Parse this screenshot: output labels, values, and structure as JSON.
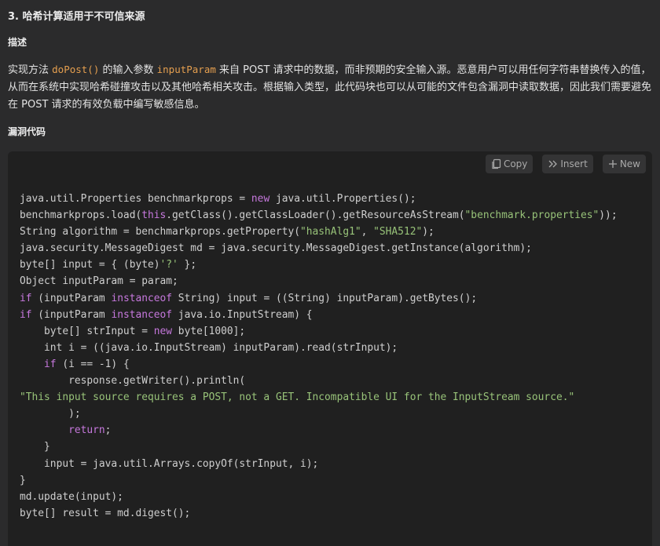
{
  "heading": "3. 哈希计算适用于不可信来源",
  "sections": {
    "description_title": "描述",
    "code_title": "漏洞代码"
  },
  "description": {
    "p1": "实现方法 ",
    "c1": "doPost()",
    "p2": " 的输入参数 ",
    "c2": "inputParam",
    "p3": " 来自 POST 请求中的数据，而非预期的安全输入源。恶意用户可以用任何字符串替换传入的值，从而在系统中实现哈希碰撞攻击以及其他哈希相关攻击。根据输入类型，此代码块也可以从可能的文件包含漏洞中读取数据，因此我们需要避免在 POST 请求的有效负载中编写敏感信息。"
  },
  "toolbar": {
    "copy_label": "Copy",
    "insert_label": "Insert",
    "new_label": "New",
    "icons": [
      "copy-icon",
      "insert-icon",
      "plus-icon"
    ]
  },
  "colors": {
    "keyword": "#c678dd",
    "string": "#98c379",
    "inline_code": "#e59f4f",
    "code_bg": "#202020",
    "page_bg": "#2b2b2c"
  },
  "code": [
    [
      [
        "p",
        "java.util.Properties benchmarkprops = "
      ],
      [
        "k",
        "new"
      ],
      [
        "p",
        " java.util.Properties();"
      ]
    ],
    [
      [
        "p",
        "benchmarkprops.load("
      ],
      [
        "k",
        "this"
      ],
      [
        "p",
        ".getClass().getClassLoader().getResourceAsStream("
      ],
      [
        "s",
        "\"benchmark.properties\""
      ],
      [
        "p",
        "));"
      ]
    ],
    [
      [
        "p",
        "String algorithm = benchmarkprops.getProperty("
      ],
      [
        "s",
        "\"hashAlg1\""
      ],
      [
        "p",
        ", "
      ],
      [
        "s",
        "\"SHA512\""
      ],
      [
        "p",
        ");"
      ]
    ],
    [
      [
        "p",
        "java.security.MessageDigest md = java.security.MessageDigest.getInstance(algorithm);"
      ]
    ],
    [
      [
        "p",
        "byte[] input = { (byte)"
      ],
      [
        "s",
        "'?'"
      ],
      [
        "p",
        " };"
      ]
    ],
    [
      [
        "p",
        "Object inputParam = param;"
      ]
    ],
    [
      [
        "k",
        "if"
      ],
      [
        "p",
        " (inputParam "
      ],
      [
        "k",
        "instanceof"
      ],
      [
        "p",
        " String) input = ((String) inputParam).getBytes();"
      ]
    ],
    [
      [
        "k",
        "if"
      ],
      [
        "p",
        " (inputParam "
      ],
      [
        "k",
        "instanceof"
      ],
      [
        "p",
        " java.io.InputStream) {"
      ]
    ],
    [
      [
        "p",
        "    byte[] strInput = "
      ],
      [
        "k",
        "new"
      ],
      [
        "p",
        " byte[1000];"
      ]
    ],
    [
      [
        "p",
        "    int i = ((java.io.InputStream) inputParam).read(strInput);"
      ]
    ],
    [
      [
        "p",
        "    "
      ],
      [
        "k",
        "if"
      ],
      [
        "p",
        " (i == -1) {"
      ]
    ],
    [
      [
        "p",
        "        response.getWriter().println("
      ]
    ],
    [
      [
        "s",
        "\"This input source requires a POST, not a GET. Incompatible UI for the InputStream source.\""
      ]
    ],
    [
      [
        "p",
        "        );"
      ]
    ],
    [
      [
        "p",
        "        "
      ],
      [
        "k",
        "return"
      ],
      [
        "p",
        ";"
      ]
    ],
    [
      [
        "p",
        "    }"
      ]
    ],
    [
      [
        "p",
        "    input = java.util.Arrays.copyOf(strInput, i);"
      ]
    ],
    [
      [
        "p",
        "}"
      ]
    ],
    [
      [
        "p",
        "md.update(input);"
      ]
    ],
    [
      [
        "p",
        "byte[] result = md.digest();"
      ]
    ]
  ]
}
